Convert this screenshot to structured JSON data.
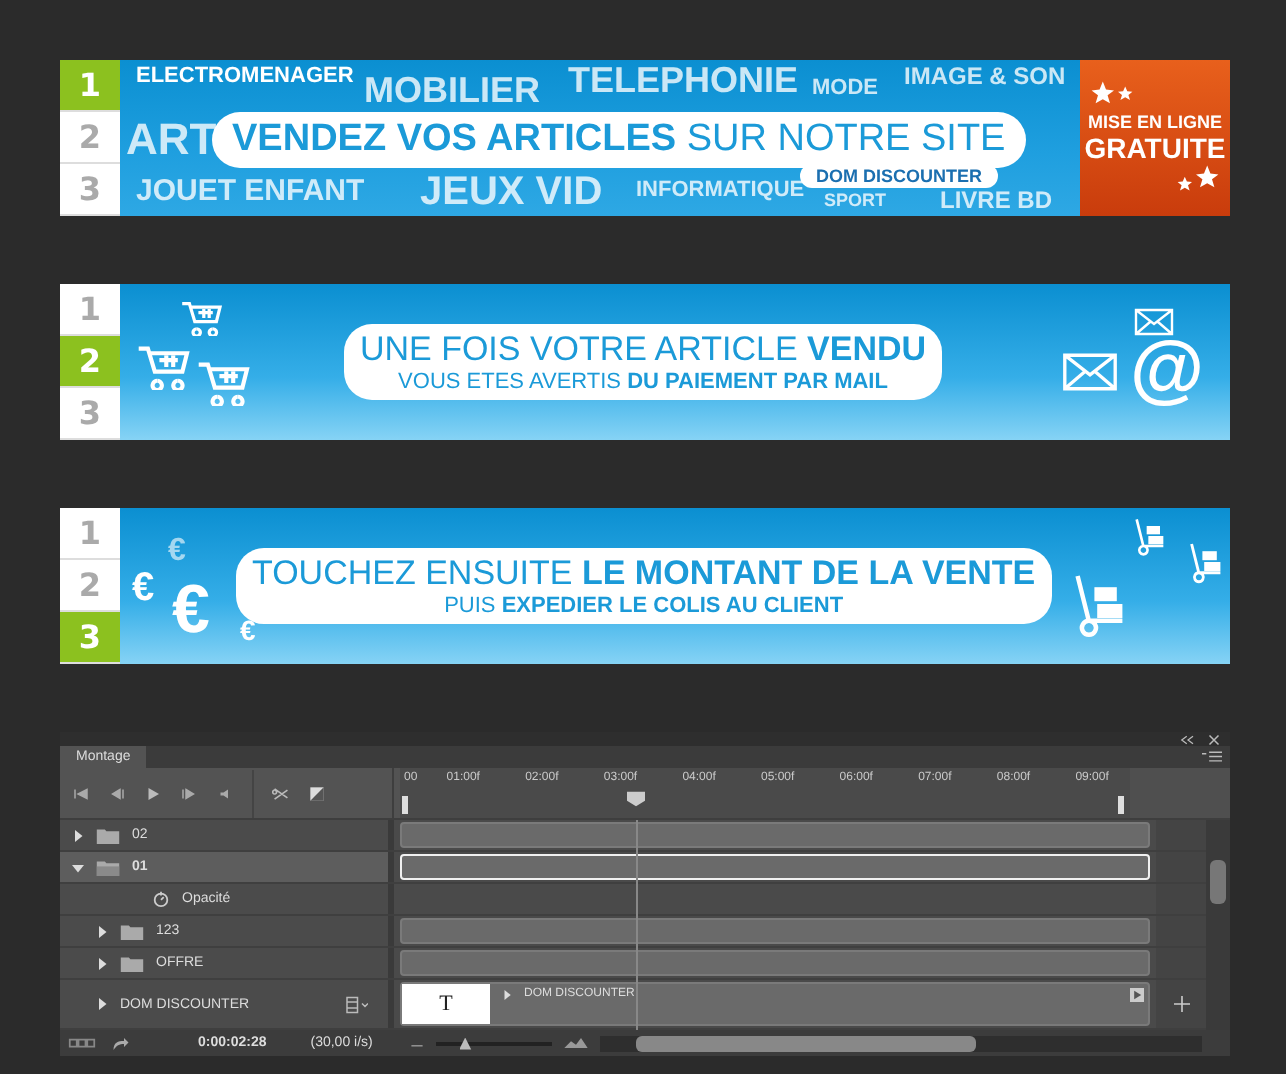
{
  "banners": [
    {
      "kind": "categories",
      "steps": [
        {
          "label": "1",
          "selected": true
        },
        {
          "label": "2",
          "selected": false
        },
        {
          "label": "3",
          "selected": false
        }
      ],
      "background_words": [
        "ELECTROMENAGER",
        "MOBILIER",
        "TELEPHONIE",
        "MODE",
        "IMAGE & SON",
        "ART",
        "JOUET ENFANT",
        "JEUX VID",
        "INFORMATIQUE",
        "SPORT",
        "LIVRE BD"
      ],
      "headline": "**VENDEZ VOS ARTICLES** SUR NOTRE SITE",
      "logo": "DOM DISCOUNTER",
      "offer": [
        "MISE EN LIGNE",
        "GRATUITE"
      ]
    },
    {
      "kind": "mail",
      "steps": [
        {
          "label": "1",
          "selected": false
        },
        {
          "label": "2",
          "selected": true
        },
        {
          "label": "3",
          "selected": false
        }
      ],
      "headline": "UNE FOIS VOTRE ARTICLE **VENDU**",
      "subline": "VOUS ETES AVERTIS **DU PAIEMENT PAR MAIL**",
      "at_sign": "@"
    },
    {
      "kind": "payment",
      "steps": [
        {
          "label": "1",
          "selected": false
        },
        {
          "label": "2",
          "selected": false
        },
        {
          "label": "3",
          "selected": true
        }
      ],
      "headline": "TOUCHEZ ENSUITE **LE MONTANT DE LA VENTE**",
      "subline": "PUIS **EXPEDIER LE COLIS AU CLIENT**",
      "euro_signs": [
        "€",
        "€",
        "€",
        "€"
      ]
    }
  ],
  "timeline": {
    "tab": "Montage",
    "ruler": [
      "00",
      "01:00f",
      "02:00f",
      "03:00f",
      "04:00f",
      "05:00f",
      "06:00f",
      "07:00f",
      "08:00f",
      "09:00f"
    ],
    "layers": [
      {
        "name": "02",
        "kind": "folder",
        "expanded": false,
        "selected": false
      },
      {
        "name": "01",
        "kind": "folder",
        "expanded": true,
        "selected": true,
        "children": [
          {
            "name": "Opacité",
            "kind": "property",
            "selected": false
          },
          {
            "name": "123",
            "kind": "folder",
            "expanded": false,
            "selected": false
          },
          {
            "name": "OFFRE",
            "kind": "folder",
            "expanded": false,
            "selected": false
          },
          {
            "name": "DOM DISCOUNTER",
            "kind": "text",
            "expanded": false,
            "selected": false,
            "thumbnail": "T",
            "clip_label": "DOM DISCOUNTER"
          }
        ]
      }
    ],
    "current_time": "0:00:02:28",
    "frame_rate": "(30,00 i/s)",
    "zoom_slider": {
      "level": 0.2
    }
  }
}
